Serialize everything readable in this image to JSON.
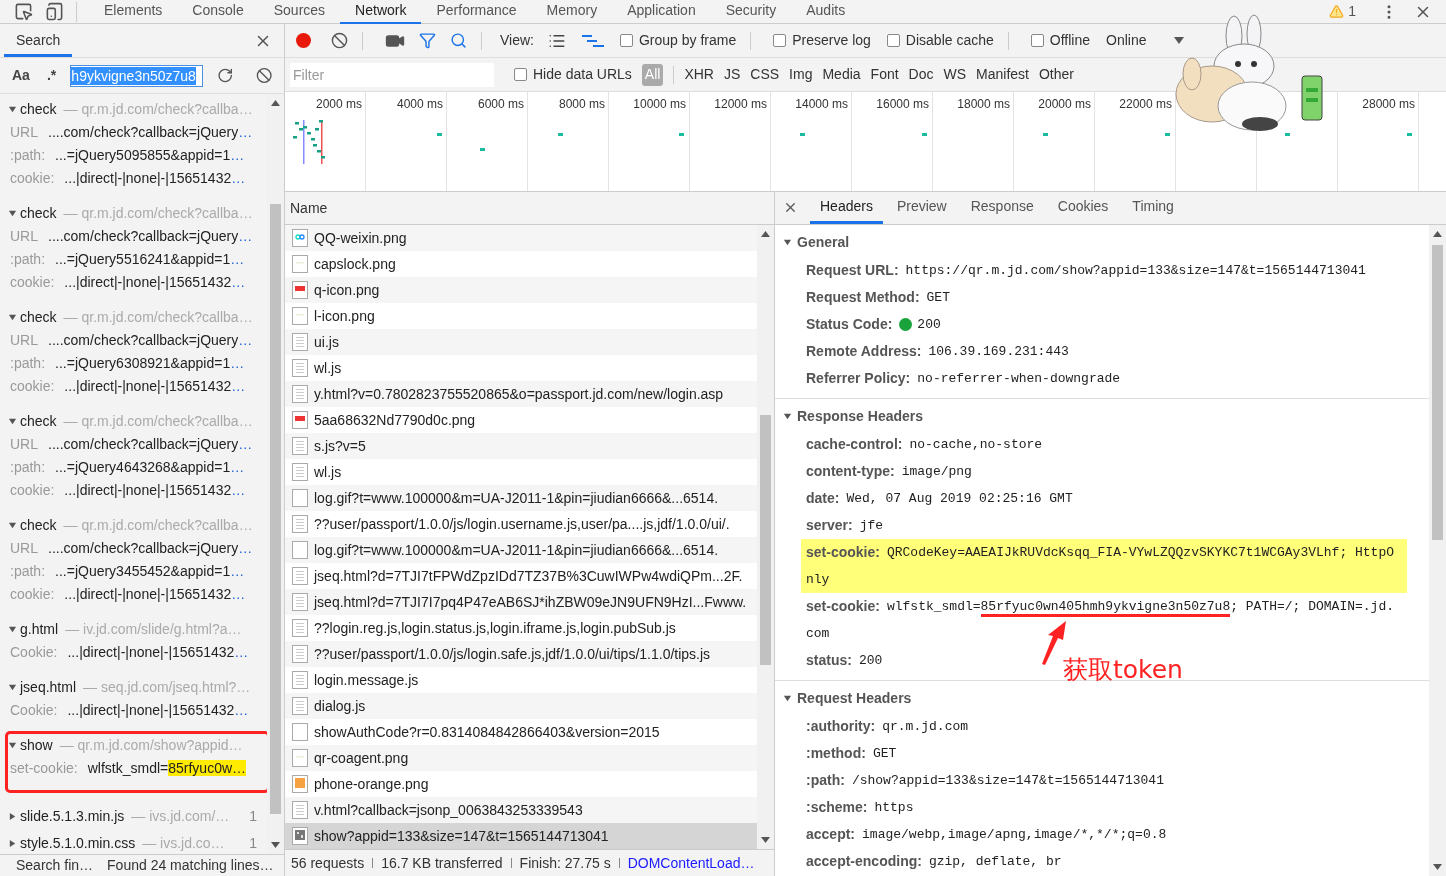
{
  "devtools_tabs": [
    {
      "label": "Elements",
      "selected": false
    },
    {
      "label": "Console",
      "selected": false
    },
    {
      "label": "Sources",
      "selected": false
    },
    {
      "label": "Network",
      "selected": true
    },
    {
      "label": "Performance",
      "selected": false
    },
    {
      "label": "Memory",
      "selected": false
    },
    {
      "label": "Application",
      "selected": false
    },
    {
      "label": "Security",
      "selected": false
    },
    {
      "label": "Audits",
      "selected": false
    }
  ],
  "warning_count": "1",
  "search_panel": {
    "tab": "Search",
    "case_toggle": "Aa",
    "regex_toggle": ".*",
    "query": "h9ykvigne3n50z7u8",
    "results": [
      {
        "name": "check",
        "url": "— qr.m.jd.com/check?callba…",
        "expanded": true,
        "annotated": false,
        "lines": [
          {
            "label": "URL",
            "value": "....com/check?callback=jQuery",
            "more": "…"
          },
          {
            "label": ":path:",
            "value": "...=jQuery5095855&appid=1",
            "more": "…"
          },
          {
            "label": "cookie:",
            "value": "...|direct|-|none|-|15651432",
            "more": "…"
          }
        ]
      },
      {
        "name": "check",
        "url": "— qr.m.jd.com/check?callba…",
        "expanded": true,
        "annotated": false,
        "lines": [
          {
            "label": "URL",
            "value": "....com/check?callback=jQuery",
            "more": "…"
          },
          {
            "label": ":path:",
            "value": "...=jQuery5516241&appid=1",
            "more": "…"
          },
          {
            "label": "cookie:",
            "value": "...|direct|-|none|-|15651432",
            "more": "…"
          }
        ]
      },
      {
        "name": "check",
        "url": "— qr.m.jd.com/check?callba…",
        "expanded": true,
        "annotated": false,
        "lines": [
          {
            "label": "URL",
            "value": "....com/check?callback=jQuery",
            "more": "…"
          },
          {
            "label": ":path:",
            "value": "...=jQuery6308921&appid=1",
            "more": "…"
          },
          {
            "label": "cookie:",
            "value": "...|direct|-|none|-|15651432",
            "more": "…"
          }
        ]
      },
      {
        "name": "check",
        "url": "— qr.m.jd.com/check?callba…",
        "expanded": true,
        "annotated": false,
        "lines": [
          {
            "label": "URL",
            "value": "....com/check?callback=jQuery",
            "more": "…"
          },
          {
            "label": ":path:",
            "value": "...=jQuery4643268&appid=1",
            "more": "…"
          },
          {
            "label": "cookie:",
            "value": "...|direct|-|none|-|15651432",
            "more": "…"
          }
        ]
      },
      {
        "name": "check",
        "url": "— qr.m.jd.com/check?callba…",
        "expanded": true,
        "annotated": false,
        "lines": [
          {
            "label": "URL",
            "value": "....com/check?callback=jQuery",
            "more": "…"
          },
          {
            "label": ":path:",
            "value": "...=jQuery3455452&appid=1",
            "more": "…"
          },
          {
            "label": "cookie:",
            "value": "...|direct|-|none|-|15651432",
            "more": "…"
          }
        ]
      },
      {
        "name": "g.html",
        "url": "— iv.jd.com/slide/g.html?a…",
        "expanded": true,
        "annotated": false,
        "lines": [
          {
            "label": "Cookie:",
            "value": "...|direct|-|none|-|15651432",
            "more": "…"
          }
        ]
      },
      {
        "name": "jseq.html",
        "url": "— seq.jd.com/jseq.html?…",
        "expanded": true,
        "annotated": false,
        "lines": [
          {
            "label": "Cookie:",
            "value": "...|direct|-|none|-|15651432",
            "more": "…"
          }
        ]
      },
      {
        "name": "show",
        "url": "— qr.m.jd.com/show?appid…",
        "expanded": true,
        "annotated": true,
        "lines": [
          {
            "label": "set-cookie:",
            "value": "wlfstk_smdl=",
            "match": "85rfyuc0w…"
          }
        ]
      },
      {
        "name": "slide.5.1.3.min.js",
        "url": "— ivs.jd.com/…",
        "count": "1",
        "expanded": false,
        "annotated": false
      },
      {
        "name": "style.5.1.0.min.css",
        "url": "— ivs.jd.co…",
        "count": "1",
        "expanded": false,
        "annotated": false
      }
    ],
    "status": [
      "Search fin…",
      "Found 24 matching lines…"
    ]
  },
  "network_toolbar": {
    "recording": true,
    "view_label": "View:",
    "checkbox_groups": [
      [
        {
          "label": "Group by frame",
          "checked": false
        }
      ],
      [
        {
          "label": "Preserve log",
          "checked": false
        },
        {
          "label": "Disable cache",
          "checked": false
        }
      ],
      [
        {
          "label": "Offline",
          "checked": false
        }
      ]
    ],
    "throttling": "Online"
  },
  "filter_bar": {
    "placeholder": "Filter",
    "hide_data_urls": {
      "label": "Hide data URLs",
      "checked": false
    },
    "all_button": {
      "label": "All",
      "selected": true
    },
    "types": [
      {
        "label": "XHR",
        "selected": false
      },
      {
        "label": "JS",
        "selected": false
      },
      {
        "label": "CSS",
        "selected": false
      },
      {
        "label": "Img",
        "selected": false
      },
      {
        "label": "Media",
        "selected": false
      },
      {
        "label": "Font",
        "selected": false
      },
      {
        "label": "Doc",
        "selected": false
      },
      {
        "label": "WS",
        "selected": false
      },
      {
        "label": "Manifest",
        "selected": false
      },
      {
        "label": "Other",
        "selected": false
      }
    ]
  },
  "timeline": {
    "columns": [
      {
        "label": "2000 ms"
      },
      {
        "label": "4000 ms"
      },
      {
        "label": "6000 ms"
      },
      {
        "label": "8000 ms"
      },
      {
        "label": "10000 ms"
      },
      {
        "label": "12000 ms"
      },
      {
        "label": "14000 ms"
      },
      {
        "label": "16000 ms"
      },
      {
        "label": "18000 ms"
      },
      {
        "label": "20000 ms"
      },
      {
        "label": "22000 ms"
      },
      {},
      {},
      {
        "label": "28000 ms"
      }
    ]
  },
  "requests": {
    "column": "Name",
    "rows": [
      {
        "name": "QQ-weixin.png",
        "kind": "qq",
        "selected": false
      },
      {
        "name": "capslock.png",
        "selected": false
      },
      {
        "name": "q-icon.png",
        "kind": "red-image",
        "selected": false
      },
      {
        "name": "l-icon.png",
        "selected": false
      },
      {
        "name": "ui.js",
        "kind": "script",
        "selected": false
      },
      {
        "name": "wl.js",
        "kind": "script",
        "selected": false
      },
      {
        "name": "y.html?v=0.7802823755520865&o=passport.jd.com/new/login.asp",
        "kind": "script",
        "selected": false
      },
      {
        "name": "5aa68632Nd7790d0c.png",
        "kind": "red-image",
        "selected": false
      },
      {
        "name": "s.js?v=5",
        "kind": "script",
        "selected": false
      },
      {
        "name": "wl.js",
        "kind": "script",
        "selected": false
      },
      {
        "name": "log.gif?t=www.100000&m=UA-J2011-1&pin=jiudian6666&...6514.",
        "kind": "blank",
        "selected": false
      },
      {
        "name": "??user/passport/1.0.0/js/login.username.js,user/pa....js,jdf/1.0.0/ui/.",
        "kind": "script",
        "selected": false
      },
      {
        "name": "log.gif?t=www.100000&m=UA-J2011-1&pin=jiudian6666&...6514.",
        "kind": "blank",
        "selected": false
      },
      {
        "name": "jseq.html?d=7TJI7tFPWdZpzIDd7TZ37B%3CuwIWPw4wdiQPm...2F.",
        "kind": "script",
        "selected": false
      },
      {
        "name": "jseq.html?d=7TJI7I7pq4P47eAB6SJ*ihZBW09eJN9UFN9HzI...Fwww.",
        "kind": "script",
        "selected": false
      },
      {
        "name": "??login.reg.js,login.status.js,login.iframe.js,login.pubSub.js",
        "kind": "script",
        "selected": false
      },
      {
        "name": "??user/passport/1.0.0/js/login.safe.js,jdf/1.0.0/ui/tips/1.1.0/tips.js",
        "kind": "script",
        "selected": false
      },
      {
        "name": "login.message.js",
        "kind": "script",
        "selected": false
      },
      {
        "name": "dialog.js",
        "kind": "script",
        "selected": false
      },
      {
        "name": "showAuthCode?r=0.8314084842866403&version=2015",
        "kind": "blank",
        "selected": false
      },
      {
        "name": "qr-coagent.png",
        "selected": false
      },
      {
        "name": "phone-orange.png",
        "kind": "orange-image",
        "selected": false
      },
      {
        "name": "v.html?callback=jsonp_0063843253339543",
        "kind": "script",
        "selected": false
      },
      {
        "name": "show?appid=133&size=147&t=1565144713041",
        "kind": "qr",
        "selected": true
      }
    ],
    "summary": [
      {
        "text": "56 requests",
        "kind": "plain"
      },
      {
        "text": "16.7 KB transferred",
        "kind": "plain"
      },
      {
        "text": "Finish: 27.75 s",
        "kind": "plain"
      },
      {
        "text": "DOMContentLoad…",
        "kind": "link"
      }
    ]
  },
  "details": {
    "tabs": [
      {
        "label": "Headers",
        "selected": true
      },
      {
        "label": "Preview",
        "selected": false
      },
      {
        "label": "Response",
        "selected": false
      },
      {
        "label": "Cookies",
        "selected": false
      },
      {
        "label": "Timing",
        "selected": false
      }
    ],
    "sections": [
      {
        "title": "General",
        "expanded": true,
        "rows": [
          {
            "key": "Request URL:",
            "value": "https://qr.m.jd.com/show?appid=133&size=147&t=1565144713041",
            "highlighted": false
          },
          {
            "key": "Request Method:",
            "value": "GET",
            "highlighted": false
          },
          {
            "key": "Status Code:",
            "value": "200",
            "color": "#1aa33a",
            "highlighted": false
          },
          {
            "key": "Remote Address:",
            "value": "106.39.169.231:443",
            "highlighted": false
          },
          {
            "key": "Referrer Policy:",
            "value": "no-referrer-when-downgrade",
            "highlighted": false
          }
        ]
      },
      {
        "title": "Response Headers",
        "expanded": true,
        "rows": [
          {
            "key": "cache-control:",
            "value": "no-cache,no-store",
            "highlighted": false
          },
          {
            "key": "content-type:",
            "value": "image/png",
            "highlighted": false
          },
          {
            "key": "date:",
            "value": "Wed, 07 Aug 2019 02:25:16 GMT",
            "highlighted": false
          },
          {
            "key": "server:",
            "value": "jfe",
            "highlighted": false
          },
          {
            "key": "set-cookie:",
            "value": "QRCodeKey=AAEAIJkRUVdcKsqq_FIA-VYwLZQQzvSKYKC7t1WCGAy3VLhf; HttpOnly",
            "highlighted": true
          },
          {
            "key": "set-cookie:",
            "value": "wlfstk_smdl=",
            "marked": "85rfyuc0wn405hmh9ykvigne3n50z7u8",
            "value_after": "; PATH=/; DOMAIN=.jd.com",
            "note": "获取token",
            "highlighted": false
          },
          {
            "key": "status:",
            "value": "200",
            "highlighted": false
          }
        ]
      },
      {
        "title": "Request Headers",
        "expanded": true,
        "rows": [
          {
            "key": ":authority:",
            "value": "qr.m.jd.com",
            "highlighted": false
          },
          {
            "key": ":method:",
            "value": "GET",
            "highlighted": false
          },
          {
            "key": ":path:",
            "value": "/show?appid=133&size=147&t=1565144713041",
            "highlighted": false
          },
          {
            "key": ":scheme:",
            "value": "https",
            "highlighted": false
          },
          {
            "key": "accept:",
            "value": "image/webp,image/apng,image/*,*/*;q=0.8",
            "highlighted": false
          },
          {
            "key": "accept-encoding:",
            "value": "gzip, deflate, br",
            "highlighted": false
          }
        ]
      }
    ]
  }
}
